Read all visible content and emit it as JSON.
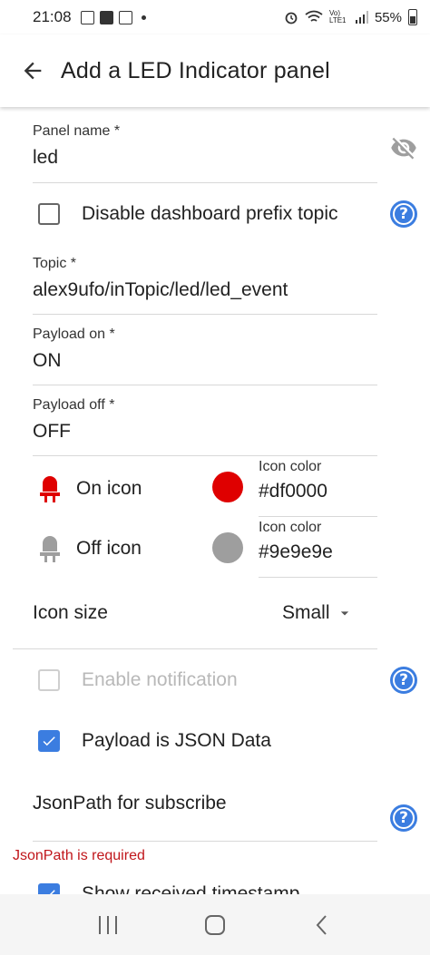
{
  "status_bar": {
    "time": "21:08",
    "battery": "55%",
    "network_label": "Vo) LTE1"
  },
  "app_bar": {
    "title": "Add a LED Indicator panel",
    "back_icon": "arrow-left-icon"
  },
  "form": {
    "panel_name": {
      "label": "Panel name *",
      "value": "led"
    },
    "disable_prefix": {
      "label": "Disable dashboard prefix topic",
      "checked": false
    },
    "topic": {
      "label": "Topic *",
      "value": "alex9ufo/inTopic/led/led_event"
    },
    "payload_on": {
      "label": "Payload on *",
      "value": "ON"
    },
    "payload_off": {
      "label": "Payload off *",
      "value": "OFF"
    },
    "on_icon": {
      "label": "On icon",
      "color_label": "Icon color",
      "color_value": "#df0000",
      "color": "#df0000"
    },
    "off_icon": {
      "label": "Off icon",
      "color_label": "Icon color",
      "color_value": "#9e9e9e",
      "color": "#9e9e9e"
    },
    "icon_size": {
      "label": "Icon size",
      "value": "Small"
    },
    "enable_notification": {
      "label": "Enable notification",
      "checked": false,
      "disabled": true
    },
    "payload_json": {
      "label": "Payload is JSON Data",
      "checked": true
    },
    "jsonpath": {
      "label": "JsonPath for subscribe",
      "error": "JsonPath is required"
    },
    "show_timestamp": {
      "label": "Show received timestamp",
      "checked": true
    }
  },
  "colors": {
    "accent": "#3b7de0",
    "error": "#c0161b"
  }
}
